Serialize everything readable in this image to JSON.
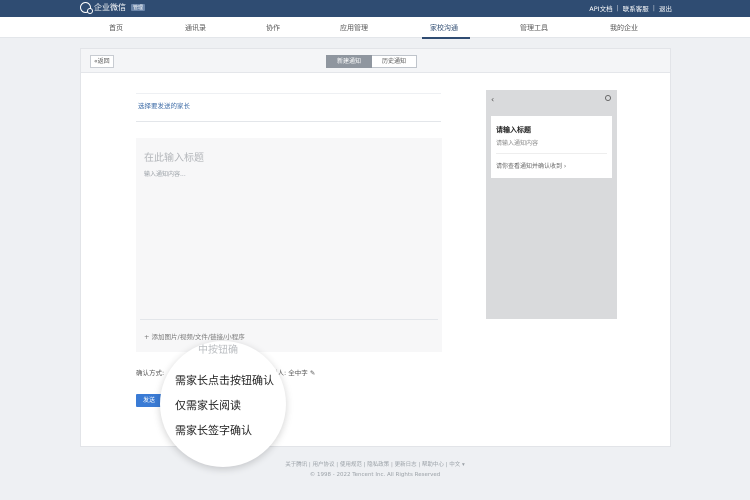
{
  "topbar": {
    "app_name": "企业微信",
    "badge": "管理",
    "links": [
      "API文档",
      "联系客服",
      "退出"
    ]
  },
  "nav": {
    "items": [
      "首页",
      "通讯录",
      "协作",
      "应用管理",
      "家校沟通",
      "管理工具",
      "我的企业"
    ],
    "active": "家校沟通"
  },
  "toolbar": {
    "back_label": "«返回",
    "tab_new": "新建通知",
    "tab_history": "历史通知"
  },
  "form": {
    "recipient_label": "选择要发送的家长",
    "title_placeholder": "在此输入标题",
    "content_placeholder": "输入通知内容...",
    "attach_label": "+ 添加图片/视频/文件/链接/小程序",
    "confirm_label": "确认方式:",
    "sender_label": "送人: 全中字",
    "send_button": "发送"
  },
  "preview": {
    "back_icon": "‹",
    "card_title": "请输入标题",
    "card_content": "请输入通知内容",
    "card_footer": "请你查看通知并确认收到 ›"
  },
  "dropdown": {
    "partial": "中按钮确",
    "options": [
      "需家长点击按钮确认",
      "仅需家长阅读",
      "需家长签字确认"
    ]
  },
  "footer": {
    "links": "关于腾讯 | 用户协议 | 使用规范 | 隐私政策 | 更新日志 | 帮助中心 | 中文 ▾",
    "copyright": "© 1998 - 2022 Tencent Inc. All Rights Reserved"
  },
  "colors": {
    "topbar": "#2f4c72",
    "accent": "#3a7bd5",
    "link": "#3b6aa6"
  }
}
